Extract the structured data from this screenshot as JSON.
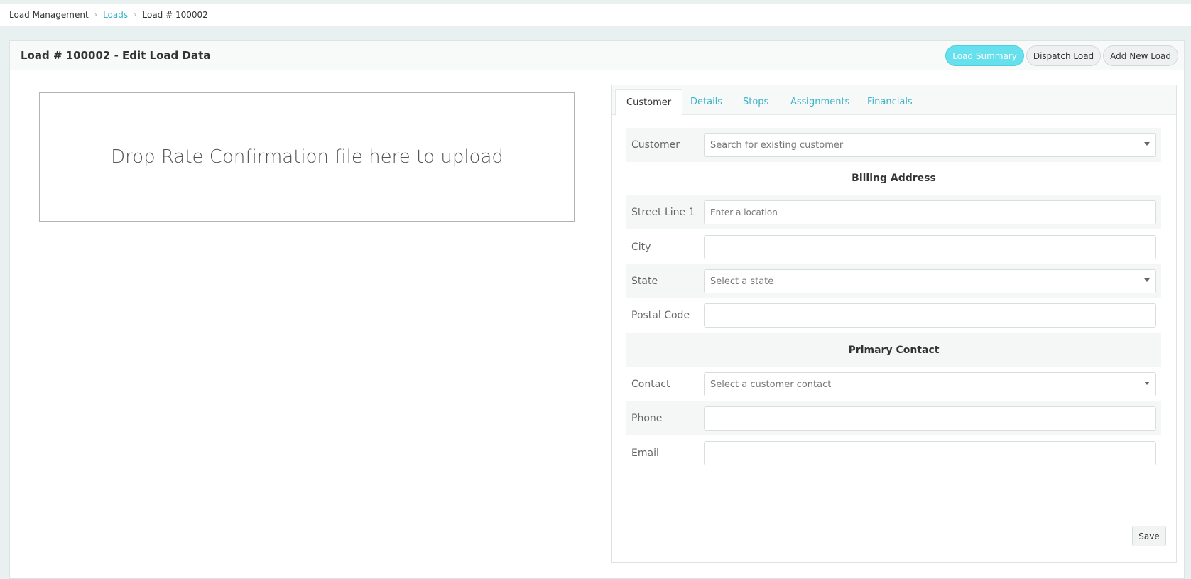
{
  "breadcrumb": {
    "root": "Load Management",
    "loads": "Loads",
    "current": "Load # 100002"
  },
  "header": {
    "title": "Load # 100002 - Edit Load Data",
    "actions": {
      "load_summary": "Load Summary",
      "dispatch_load": "Dispatch Load",
      "add_new_load": "Add New Load"
    }
  },
  "dropzone": {
    "text": "Drop Rate Confirmation file here to upload"
  },
  "tabs": [
    "Customer",
    "Details",
    "Stops",
    "Assignments",
    "Financials"
  ],
  "form": {
    "customer": {
      "label": "Customer",
      "placeholder": "Search for existing customer"
    },
    "billing_title": "Billing Address",
    "street": {
      "label": "Street Line 1",
      "placeholder": "Enter a location"
    },
    "city": {
      "label": "City",
      "value": ""
    },
    "state": {
      "label": "State",
      "placeholder": "Select a state"
    },
    "postal": {
      "label": "Postal Code",
      "value": ""
    },
    "contact_title": "Primary Contact",
    "contact": {
      "label": "Contact",
      "placeholder": "Select a customer contact"
    },
    "phone": {
      "label": "Phone",
      "value": ""
    },
    "email": {
      "label": "Email",
      "value": ""
    },
    "save": "Save"
  },
  "colors": {
    "accent": "#3bb4c8",
    "active_button": "#66e0ec",
    "background": "#e9f0f0"
  }
}
